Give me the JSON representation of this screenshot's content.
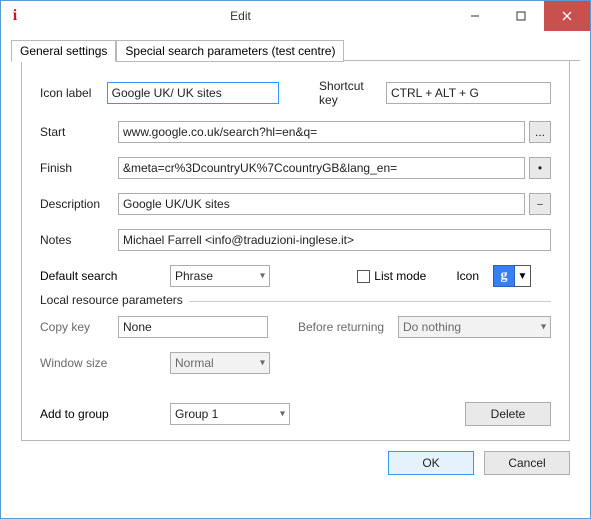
{
  "window": {
    "title": "Edit"
  },
  "tabs": {
    "general": "General settings",
    "special": "Special search parameters (test centre)"
  },
  "labels": {
    "iconLabel": "Icon label",
    "shortcutKey": "Shortcut key",
    "start": "Start",
    "finish": "Finish",
    "description": "Description",
    "notes": "Notes",
    "defaultSearch": "Default search",
    "listMode": "List mode",
    "icon": "Icon",
    "localGroup": "Local resource parameters",
    "copyKey": "Copy key",
    "beforeReturning": "Before returning",
    "windowSize": "Window size",
    "addToGroup": "Add to group"
  },
  "values": {
    "iconLabel": "Google UK/ UK sites",
    "shortcutKey": "CTRL + ALT + G",
    "start": "www.google.co.uk/search?hl=en&q=",
    "finish": "&meta=cr%3DcountryUK%7CcountryGB&lang_en=",
    "description": "Google UK/UK sites",
    "notes": "Michael Farrell <info@traduzioni-inglese.it>",
    "defaultSearch": "Phrase",
    "copyKey": "None",
    "beforeReturning": "Do nothing",
    "windowSize": "Normal",
    "addToGroup": "Group 1",
    "iconGlyph": "g",
    "listModeChecked": false
  },
  "buttons": {
    "ellipsis": "...",
    "dot": "•",
    "dash": "–",
    "delete": "Delete",
    "ok": "OK",
    "cancel": "Cancel"
  }
}
